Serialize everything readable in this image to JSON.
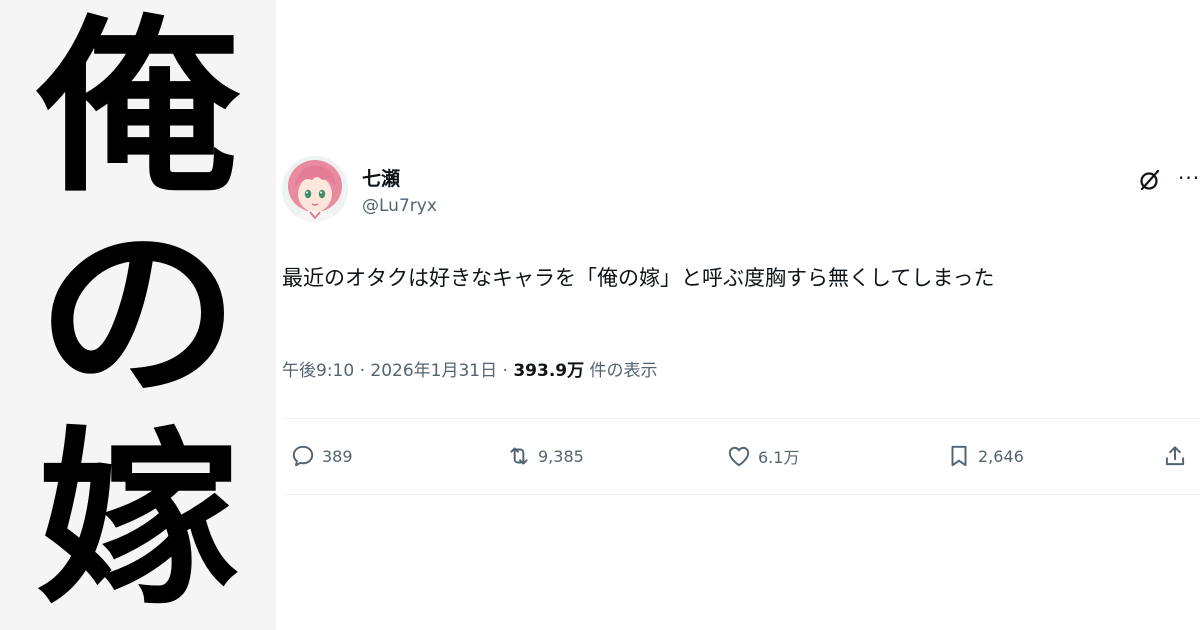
{
  "left_panel": {
    "characters": [
      "俺",
      "の",
      "嫁"
    ]
  },
  "tweet": {
    "author": {
      "display_name": "七瀬",
      "handle": "@Lu7ryx"
    },
    "text": "最近のオタクは好きなキャラを「俺の嫁」と呼ぶ度胸すら無くしてしまった",
    "meta": {
      "time": "午後9:10",
      "separator": " · ",
      "date": "2026年1月31日",
      "views_count": "393.9万",
      "views_label": " 件の表示"
    },
    "actions": {
      "reply_count": "389",
      "retweet_count": "9,385",
      "like_count": "6.1万",
      "bookmark_count": "2,646"
    },
    "more_label": "···"
  },
  "colors": {
    "text_primary": "#0f1419",
    "text_secondary": "#536471",
    "divider": "#eff3f4",
    "left_panel_bg": "#f5f5f5"
  },
  "icons": {
    "grok": "grok-icon",
    "more": "more-icon",
    "reply": "reply-icon",
    "retweet": "retweet-icon",
    "like": "heart-icon",
    "bookmark": "bookmark-icon",
    "share": "share-icon"
  }
}
